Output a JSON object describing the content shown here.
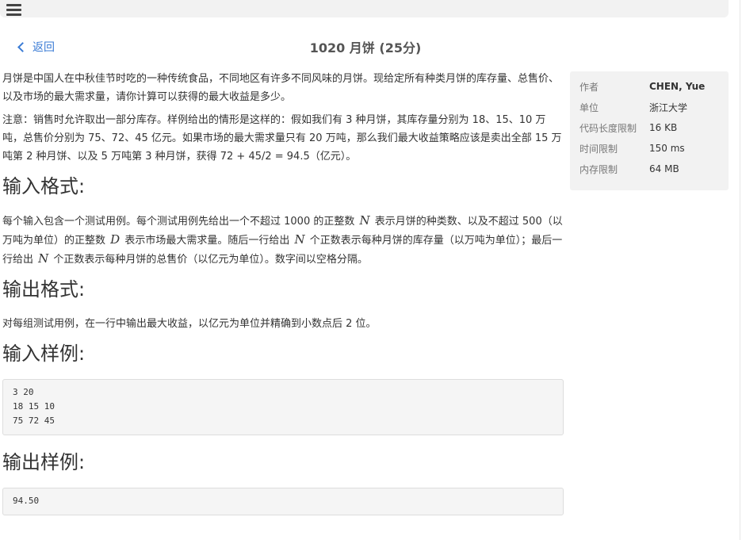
{
  "header": {
    "menu_icon": "hamburger-menu-icon"
  },
  "nav": {
    "back_label": "返回",
    "back_icon": "chevron-left-icon"
  },
  "problem": {
    "title": "1020 月饼 (25分)",
    "description": [
      "月饼是中国人在中秋佳节时吃的一种传统食品，不同地区有许多不同风味的月饼。现给定所有种类月饼的库存量、总售价、以及市场的最大需求量，请你计算可以获得的最大收益是多少。",
      "注意：销售时允许取出一部分库存。样例给出的情形是这样的：假如我们有 3 种月饼，其库存量分别为 18、15、10 万吨，总售价分别为 75、72、45 亿元。如果市场的最大需求量只有 20 万吨，那么我们最大收益策略应该是卖出全部 15 万吨第 2 种月饼、以及 5 万吨第 3 种月饼，获得 72 + 45/2 = 94.5（亿元）。"
    ],
    "input_heading": "输入格式:",
    "input_text": {
      "part1": "每个输入包含一个测试用例。每个测试用例先给出一个不超过 1000 的正整数",
      "var_n": "N",
      "part2": "表示月饼的种类数、以及不超过 500（以万吨为单位）的正整数",
      "var_d": "D",
      "part3": "表示市场最大需求量。随后一行给出",
      "part4": "个正数表示每种月饼的库存量（以万吨为单位）；最后一行给出",
      "part5": "个正数表示每种月饼的总售价（以亿元为单位）。数字间以空格分隔。"
    },
    "output_heading": "输出格式:",
    "output_text": "对每组测试用例，在一行中输出最大收益，以亿元为单位并精确到小数点后 2 位。",
    "sample_input_heading": "输入样例:",
    "sample_input": "3 20\n18 15 10\n75 72 45",
    "sample_output_heading": "输出样例:",
    "sample_output": "94.50"
  },
  "info": {
    "author_label": "作者",
    "author": "CHEN, Yue",
    "org_label": "单位",
    "org": "浙江大学",
    "code_len_label": "代码长度限制",
    "code_len": "16 KB",
    "time_label": "时间限制",
    "time": "150 ms",
    "mem_label": "内存限制",
    "mem": "64 MB"
  }
}
